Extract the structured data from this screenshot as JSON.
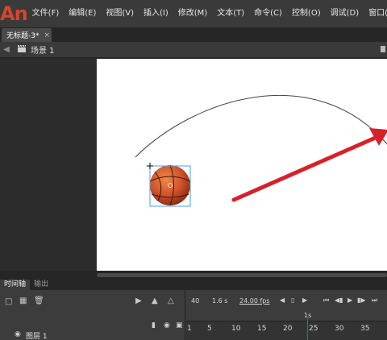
{
  "app": {
    "logo": "An"
  },
  "menu": [
    "文件(F)",
    "编辑(E)",
    "视图(V)",
    "插入(I)",
    "修改(M)",
    "文本(T)",
    "命令(C)",
    "控制(O)",
    "调试(D)",
    "窗口("
  ],
  "document_tab": {
    "title": "无标题-3*",
    "close": "×"
  },
  "scene": {
    "back_icon": "arrow-left-icon",
    "icon": "clapperboard-icon",
    "label": "场景 1"
  },
  "stage": {
    "background": "#ffffff",
    "motion_path_color": "#444444",
    "arrow_color": "#d8202a",
    "ball_colors": {
      "base": "#d2512a",
      "highlight": "#f08a4a",
      "seam": "#3a1a10"
    },
    "selection_color": "#4aa3df"
  },
  "panel_tabs": {
    "timeline": "时间轴",
    "output": "输出"
  },
  "timeline": {
    "current_frame": "40",
    "elapsed": "1.6 s",
    "fps": "24.00 fps",
    "second_label": "1s",
    "ruler_ticks": [
      "1",
      "5",
      "10",
      "15",
      "20",
      "25",
      "30",
      "35"
    ],
    "layer_name": "图层 1"
  }
}
